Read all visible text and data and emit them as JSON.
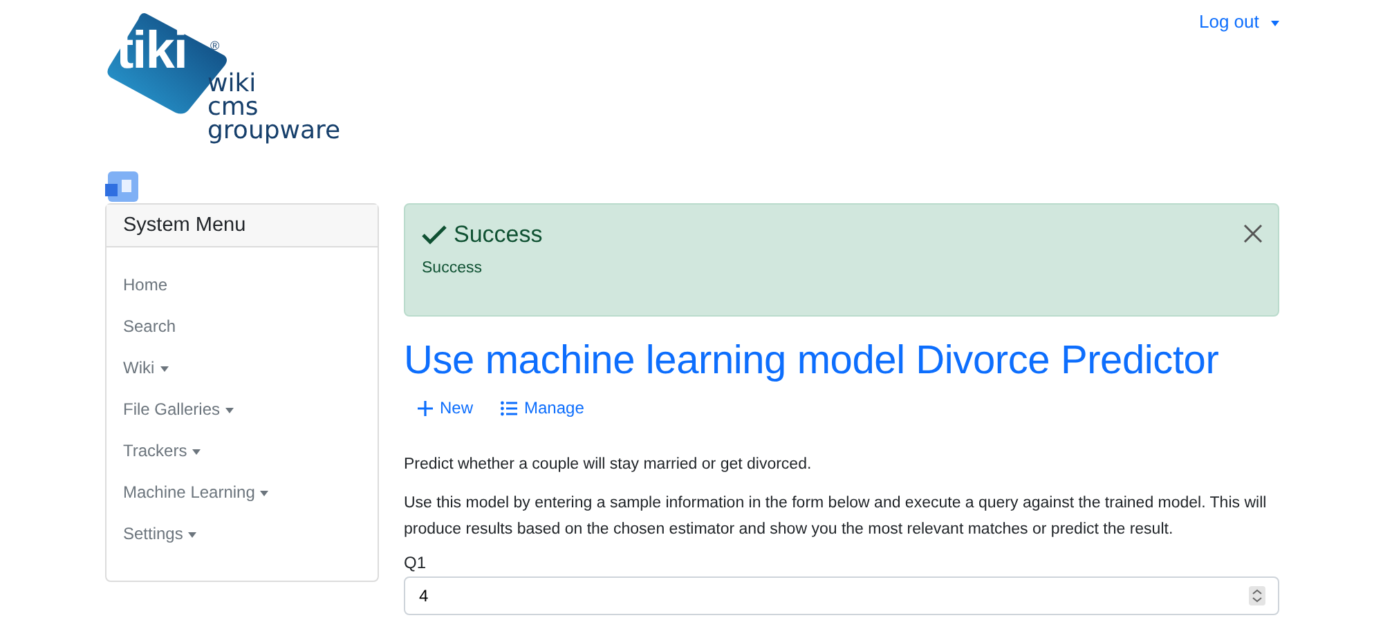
{
  "logo": {
    "mark": "tiki",
    "registered": "®",
    "lines": [
      "wiki",
      "cms",
      "groupware"
    ]
  },
  "user_menu": {
    "label": "Log out"
  },
  "sidebar": {
    "title": "System Menu",
    "items": [
      {
        "label": "Home",
        "dropdown": false
      },
      {
        "label": "Search",
        "dropdown": false
      },
      {
        "label": "Wiki",
        "dropdown": true
      },
      {
        "label": "File Galleries",
        "dropdown": true
      },
      {
        "label": "Trackers",
        "dropdown": true
      },
      {
        "label": "Machine Learning",
        "dropdown": true
      },
      {
        "label": "Settings",
        "dropdown": true
      }
    ]
  },
  "alert": {
    "title": "Success",
    "message": "Success"
  },
  "page": {
    "title": "Use machine learning model Divorce Predictor",
    "actions": [
      {
        "kind": "new",
        "label": "New"
      },
      {
        "kind": "manage",
        "label": "Manage"
      }
    ],
    "paragraphs": [
      "Predict whether a couple will stay married or get divorced.",
      "Use this model by entering a sample information in the form below and execute a query against the trained model. This will produce results based on the chosen estimator and show you the most relevant matches or predict the result."
    ],
    "fields": [
      {
        "label": "Q1",
        "value": "4"
      }
    ]
  }
}
